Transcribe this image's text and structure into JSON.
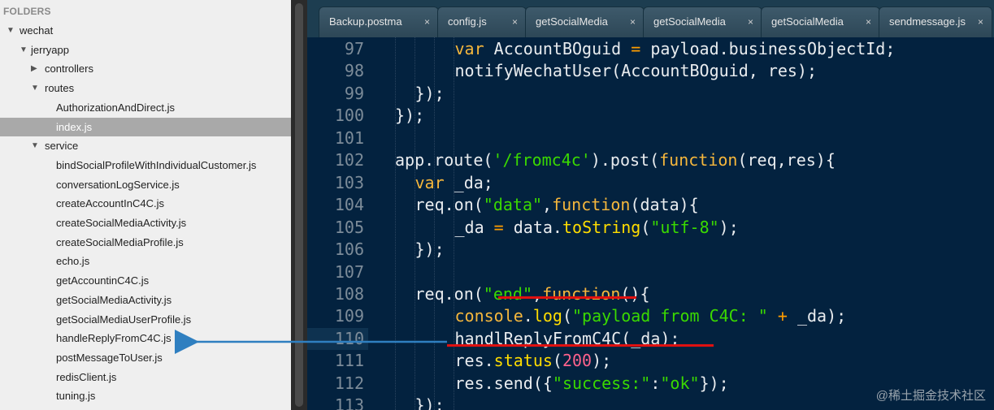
{
  "sidebar": {
    "header": "FOLDERS",
    "tree": [
      {
        "label": "wechat",
        "arrow": "▼",
        "level": 0
      },
      {
        "label": "jerryapp",
        "arrow": "▼",
        "level": 1
      },
      {
        "label": "controllers",
        "arrow": "▶",
        "level": 2
      },
      {
        "label": "routes",
        "arrow": "▼",
        "level": 2
      },
      {
        "label": "AuthorizationAndDirect.js",
        "arrow": "",
        "level": 3
      },
      {
        "label": "index.js",
        "arrow": "",
        "level": 3,
        "selected": true
      },
      {
        "label": "service",
        "arrow": "▼",
        "level": 2
      },
      {
        "label": "bindSocialProfileWithIndividualCustomer.js",
        "arrow": "",
        "level": 3
      },
      {
        "label": "conversationLogService.js",
        "arrow": "",
        "level": 3
      },
      {
        "label": "createAccountInC4C.js",
        "arrow": "",
        "level": 3
      },
      {
        "label": "createSocialMediaActivity.js",
        "arrow": "",
        "level": 3
      },
      {
        "label": "createSocialMediaProfile.js",
        "arrow": "",
        "level": 3
      },
      {
        "label": "echo.js",
        "arrow": "",
        "level": 3
      },
      {
        "label": "getAccountinC4C.js",
        "arrow": "",
        "level": 3
      },
      {
        "label": "getSocialMediaActivity.js",
        "arrow": "",
        "level": 3
      },
      {
        "label": "getSocialMediaUserProfile.js",
        "arrow": "",
        "level": 3
      },
      {
        "label": "handleReplyFromC4C.js",
        "arrow": "",
        "level": 3
      },
      {
        "label": "postMessageToUser.js",
        "arrow": "",
        "level": 3
      },
      {
        "label": "redisClient.js",
        "arrow": "",
        "level": 3
      },
      {
        "label": "tuning.js",
        "arrow": "",
        "level": 3
      }
    ]
  },
  "tabs": [
    {
      "label": "Backup.postma"
    },
    {
      "label": "config.js"
    },
    {
      "label": "getSocialMedia"
    },
    {
      "label": "getSocialMedia"
    },
    {
      "label": "getSocialMedia"
    },
    {
      "label": "sendmessage.js"
    }
  ],
  "tab_close_glyph": "×",
  "editor": {
    "lines": [
      {
        "n": "97",
        "indent": "    ",
        "tokens": [
          [
            "var ",
            "kw"
          ],
          [
            "AccountBOguid ",
            "pl"
          ],
          [
            "= ",
            "op"
          ],
          [
            "payload.businessObjectId;",
            "pl"
          ]
        ]
      },
      {
        "n": "98",
        "indent": "    ",
        "tokens": [
          [
            "notifyWechatUser(AccountBOguid, res);",
            "pl"
          ]
        ]
      },
      {
        "n": "99",
        "indent": "",
        "tokens": [
          [
            "});",
            "pl"
          ]
        ]
      },
      {
        "n": "100",
        "indent": "",
        "tokens": [
          [
            "});",
            "pl"
          ]
        ]
      },
      {
        "n": "101",
        "indent": "",
        "tokens": []
      },
      {
        "n": "102",
        "indent": "",
        "tokens": [
          [
            "app.route(",
            "pl"
          ],
          [
            "'/fromc4c'",
            "str"
          ],
          [
            ").post(",
            "pl"
          ],
          [
            "function",
            "kw"
          ],
          [
            "(req,res){",
            "pl"
          ]
        ]
      },
      {
        "n": "103",
        "indent": "",
        "tokens": [
          [
            "var ",
            "kw"
          ],
          [
            "_da;",
            "pl"
          ]
        ]
      },
      {
        "n": "104",
        "indent": "",
        "tokens": [
          [
            "req.on(",
            "pl"
          ],
          [
            "\"data\"",
            "str"
          ],
          [
            ",",
            "pl"
          ],
          [
            "function",
            "kw"
          ],
          [
            "(data){",
            "pl"
          ]
        ]
      },
      {
        "n": "105",
        "indent": "    ",
        "tokens": [
          [
            "_da ",
            "pl"
          ],
          [
            "= ",
            "op"
          ],
          [
            "data.",
            "pl"
          ],
          [
            "toString",
            "fn"
          ],
          [
            "(",
            "pl"
          ],
          [
            "\"utf-8\"",
            "str"
          ],
          [
            ");",
            "pl"
          ]
        ]
      },
      {
        "n": "106",
        "indent": "",
        "tokens": [
          [
            "});",
            "pl"
          ]
        ]
      },
      {
        "n": "107",
        "indent": "",
        "tokens": []
      },
      {
        "n": "108",
        "indent": "",
        "tokens": [
          [
            "req.on(",
            "pl"
          ],
          [
            "\"end\"",
            "str"
          ],
          [
            ",",
            "pl"
          ],
          [
            "function",
            "kw"
          ],
          [
            "(){",
            "pl"
          ]
        ]
      },
      {
        "n": "109",
        "indent": "    ",
        "tokens": [
          [
            "console",
            "kw"
          ],
          [
            ".",
            "pl"
          ],
          [
            "log",
            "fn"
          ],
          [
            "(",
            "pl"
          ],
          [
            "\"payload from C4C: \"",
            "str"
          ],
          [
            " + ",
            "op"
          ],
          [
            "_da);",
            "pl"
          ]
        ]
      },
      {
        "n": "110",
        "indent": "    ",
        "tokens": [
          [
            "handlReplyFromC4C(_da);",
            "pl"
          ]
        ]
      },
      {
        "n": "111",
        "indent": "    ",
        "tokens": [
          [
            "res.",
            "pl"
          ],
          [
            "status",
            "fn"
          ],
          [
            "(",
            "pl"
          ],
          [
            "200",
            "num"
          ],
          [
            ");",
            "pl"
          ]
        ]
      },
      {
        "n": "112",
        "indent": "    ",
        "tokens": [
          [
            "res.send({",
            "pl"
          ],
          [
            "\"success:\"",
            "str"
          ],
          [
            ":",
            "pl"
          ],
          [
            "\"ok\"",
            "str"
          ],
          [
            "});",
            "pl"
          ]
        ]
      },
      {
        "n": "113",
        "indent": "",
        "tokens": [
          [
            "});",
            "pl"
          ]
        ]
      }
    ],
    "highlighted_line": "110"
  },
  "watermark": "@稀土掘金技术社区"
}
